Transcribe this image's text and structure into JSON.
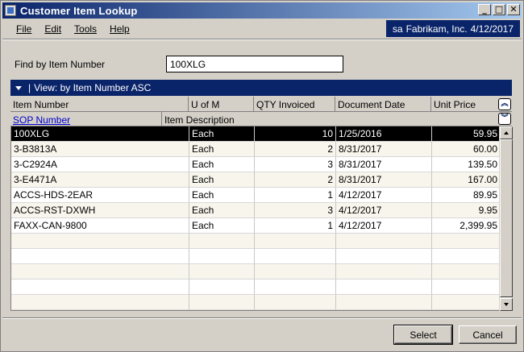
{
  "window": {
    "title": "Customer Item Lookup"
  },
  "title_buttons": {
    "minimize": "_",
    "maximize": "□",
    "close": "✕"
  },
  "menu": [
    {
      "label": "File"
    },
    {
      "label": "Edit"
    },
    {
      "label": "Tools"
    },
    {
      "label": "Help"
    }
  ],
  "session": {
    "user": "sa",
    "company": "Fabrikam, Inc.",
    "date": "4/12/2017"
  },
  "find": {
    "label": "Find by Item Number",
    "value": "100XLG"
  },
  "view": {
    "label": "View: by Item Number ASC"
  },
  "columns": {
    "item_number": "Item Number",
    "u_of_m": "U of M",
    "qty_invoiced": "QTY Invoiced",
    "document_date": "Document Date",
    "unit_price": "Unit Price",
    "sop_number": "SOP Number",
    "item_description": "Item Description"
  },
  "rows": [
    {
      "item": "100XLG",
      "uom": "Each",
      "qty": "10",
      "date": "1/25/2016",
      "price": "59.95"
    },
    {
      "item": "3-B3813A",
      "uom": "Each",
      "qty": "2",
      "date": "8/31/2017",
      "price": "60.00"
    },
    {
      "item": "3-C2924A",
      "uom": "Each",
      "qty": "3",
      "date": "8/31/2017",
      "price": "139.50"
    },
    {
      "item": "3-E4471A",
      "uom": "Each",
      "qty": "2",
      "date": "8/31/2017",
      "price": "167.00"
    },
    {
      "item": "ACCS-HDS-2EAR",
      "uom": "Each",
      "qty": "1",
      "date": "4/12/2017",
      "price": "89.95"
    },
    {
      "item": "ACCS-RST-DXWH",
      "uom": "Each",
      "qty": "3",
      "date": "4/12/2017",
      "price": "9.95"
    },
    {
      "item": "FAXX-CAN-9800",
      "uom": "Each",
      "qty": "1",
      "date": "4/12/2017",
      "price": "2,399.95"
    },
    {
      "item": "",
      "uom": "",
      "qty": "",
      "date": "",
      "price": ""
    },
    {
      "item": "",
      "uom": "",
      "qty": "",
      "date": "",
      "price": ""
    },
    {
      "item": "",
      "uom": "",
      "qty": "",
      "date": "",
      "price": ""
    },
    {
      "item": "",
      "uom": "",
      "qty": "",
      "date": "",
      "price": ""
    },
    {
      "item": "",
      "uom": "",
      "qty": "",
      "date": "",
      "price": ""
    }
  ],
  "selected_row": 0,
  "buttons": {
    "select": "Select",
    "cancel": "Cancel"
  },
  "colors": {
    "titlebar": "#0a246a",
    "selected_row": "#000000",
    "alt_row": "#f8f5ec",
    "link": "#0000cc"
  }
}
